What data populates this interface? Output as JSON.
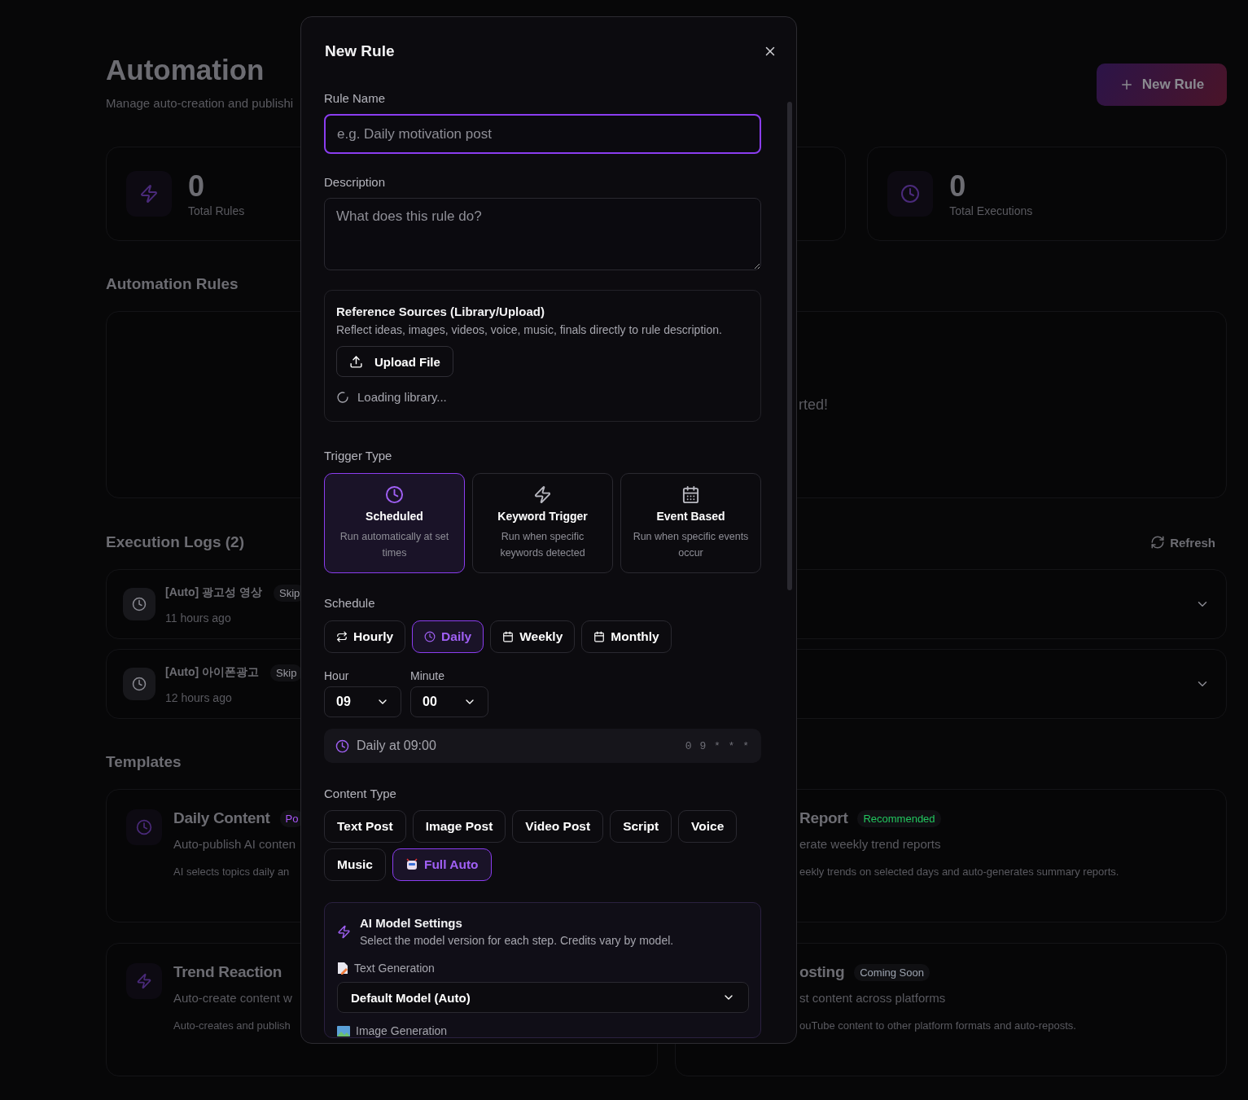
{
  "page": {
    "title": "Automation",
    "subtitle": "Manage auto-creation and publishi",
    "new_rule_button": "New Rule"
  },
  "stats": [
    {
      "kind": "stat",
      "value": "0",
      "label": "Total Rules"
    },
    {
      "kind": "covered"
    },
    {
      "kind": "stat",
      "value": "0",
      "label": "Total Executions"
    }
  ],
  "rules_section": {
    "title": "Automation Rules",
    "empty_text": "rted!"
  },
  "logs": {
    "title": "Execution Logs (2)",
    "refresh_button": "Refresh",
    "rows": [
      {
        "title": "[Auto] 광고성 영상",
        "badge": "Skip",
        "time": "11 hours ago"
      },
      {
        "title": "[Auto] 아이폰광고",
        "badge": "Skip",
        "time": "12 hours ago"
      }
    ]
  },
  "templates": {
    "title": "Templates",
    "cards": [
      {
        "title": "Daily Content",
        "badge": {
          "text": "Po",
          "color": "#a855f7"
        },
        "subtitle": "Auto-publish AI conten",
        "description": "AI selects topics daily an"
      },
      {
        "title": "Report",
        "badge": {
          "text": "Recommended",
          "color": "#22c55e"
        },
        "subtitle": "erate weekly trend reports",
        "description": "eekly trends on selected days and auto-generates summary reports."
      },
      {
        "title": "Trend Reaction",
        "subtitle": "Auto-create content w",
        "description": "Auto-creates and publish"
      },
      {
        "title": "osting",
        "badge": {
          "text": "Coming Soon",
          "color": "#9ca3af"
        },
        "subtitle": "st content across platforms",
        "description": "ouTube content to other platform formats and auto-reposts."
      }
    ]
  },
  "dialog": {
    "title": "New Rule",
    "rule_name": {
      "label": "Rule Name",
      "placeholder": "e.g. Daily motivation post"
    },
    "description": {
      "label": "Description",
      "placeholder": "What does this rule do?"
    },
    "reference": {
      "title": "Reference Sources (Library/Upload)",
      "text": "Reflect ideas, images, videos, voice, music, finals directly to rule description.",
      "upload_button": "Upload File",
      "loading": "Loading library..."
    },
    "trigger": {
      "label": "Trigger Type",
      "options": [
        {
          "title": "Scheduled",
          "description": "Run automatically at set times",
          "selected": true
        },
        {
          "title": "Keyword Trigger",
          "description": "Run when specific keywords detected",
          "selected": false
        },
        {
          "title": "Event Based",
          "description": "Run when specific events occur",
          "selected": false
        }
      ]
    },
    "schedule": {
      "label": "Schedule",
      "options": [
        {
          "label": "Hourly",
          "selected": false
        },
        {
          "label": "Daily",
          "selected": true
        },
        {
          "label": "Weekly",
          "selected": false
        },
        {
          "label": "Monthly",
          "selected": false
        }
      ],
      "hour": {
        "label": "Hour",
        "value": "09"
      },
      "minute": {
        "label": "Minute",
        "value": "00"
      },
      "summary": "Daily at 09:00",
      "cron": "0 9 * * *"
    },
    "content_type": {
      "label": "Content Type",
      "options": [
        {
          "label": "Text Post",
          "selected": false
        },
        {
          "label": "Image Post",
          "selected": false
        },
        {
          "label": "Video Post",
          "selected": false
        },
        {
          "label": "Script",
          "selected": false
        },
        {
          "label": "Voice",
          "selected": false
        },
        {
          "label": "Music",
          "selected": false
        },
        {
          "label": "Full Auto",
          "selected": true,
          "with_icon": true
        }
      ]
    },
    "model_settings": {
      "title": "AI Model Settings",
      "text": "Select the model version for each step. Credits vary by model.",
      "steps": [
        {
          "label": "Text Generation",
          "value": "Default Model (Auto)"
        },
        {
          "label": "Image Generation"
        }
      ]
    }
  }
}
